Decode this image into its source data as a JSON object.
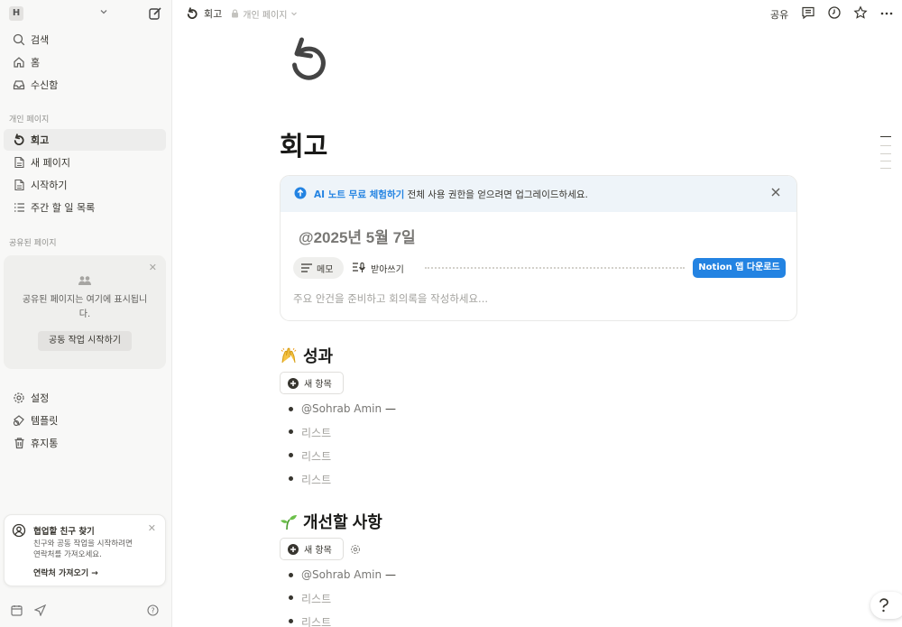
{
  "sidebar": {
    "workspace_initial": "H",
    "nav": [
      {
        "label": "검색",
        "icon": "search-icon"
      },
      {
        "label": "홈",
        "icon": "home-icon"
      },
      {
        "label": "수신함",
        "icon": "inbox-icon"
      }
    ],
    "private_section_title": "개인 페이지",
    "private_pages": [
      {
        "label": "회고",
        "icon": "undo-arrow-icon",
        "active": true
      },
      {
        "label": "새 페이지",
        "icon": "page-icon"
      },
      {
        "label": "시작하기",
        "icon": "page-icon"
      },
      {
        "label": "주간 할 일 목록",
        "icon": "list-icon"
      }
    ],
    "shared_section_title": "공유된 페이지",
    "shared_card": {
      "message": "공유된 페이지는 여기에 표시됩니다.",
      "button": "공동 작업 시작하기"
    },
    "bottom_nav": [
      {
        "label": "설정",
        "icon": "gear-icon"
      },
      {
        "label": "템플릿",
        "icon": "template-icon"
      },
      {
        "label": "휴지통",
        "icon": "trash-icon"
      }
    ],
    "invite_card": {
      "title": "협업할 친구 찾기",
      "description": "친구와 공동 작업을 시작하려면 연락처를 가져오세요.",
      "link": "연락처 가져오기"
    }
  },
  "topbar": {
    "page_title": "회고",
    "privacy_label": "개인 페이지",
    "share_label": "공유"
  },
  "page": {
    "title": "회고",
    "ai_card": {
      "banner_link": "AI 노트 무료 체험하기",
      "banner_text": " 전체 사용 권한을 얻으려면 업그레이드하세요.",
      "date": "@2025년 5월 7일",
      "tab_memo": "메모",
      "tab_transcript": "받아쓰기",
      "download_button": "Notion 앱 다운로드",
      "placeholder": "주요 안건을 준비하고 회의록을 작성하세요..."
    },
    "sections": [
      {
        "emoji_icon": "raised-hands-icon",
        "heading": "성과",
        "new_button": "새 항목",
        "mention": "@Sohrab Amin",
        "mention_suffix": " —",
        "items": [
          "리스트",
          "리스트",
          "리스트"
        ]
      },
      {
        "emoji_icon": "seedling-icon",
        "heading": "개선할 사항",
        "new_button": "새 항목",
        "mention": "@Sohrab Amin",
        "mention_suffix": " —",
        "items": [
          "리스트",
          "리스트"
        ]
      }
    ]
  },
  "colors": {
    "accent": "#2383e2",
    "sidebar_bg": "#f8f8f7",
    "text": "#37352f"
  }
}
